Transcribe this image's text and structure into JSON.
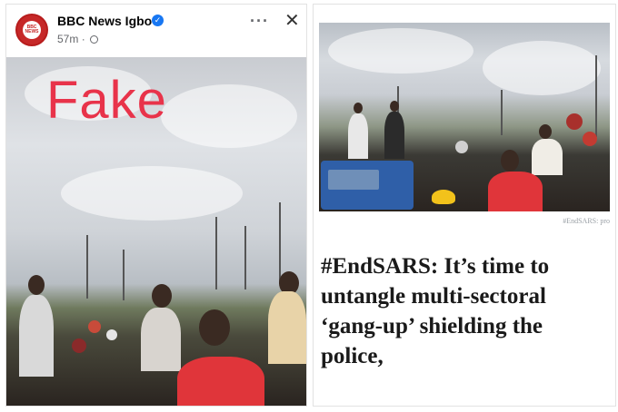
{
  "post": {
    "page_name": "BBC News Igbo",
    "time_ago": "57m",
    "time_separator": "·",
    "avatar_text": "BBC NEWS",
    "more_icon": "···",
    "close_icon": "✕",
    "verified_icon": "✓"
  },
  "left_image": {
    "overlay_label": "Fake",
    "overlay_color": "#e8334a"
  },
  "right_image": {
    "watermark": "#EndSARS: pro",
    "headline": "#EndSARS: It’s time to untangle multi-sectoral ‘gang-up’ shielding the police,"
  }
}
